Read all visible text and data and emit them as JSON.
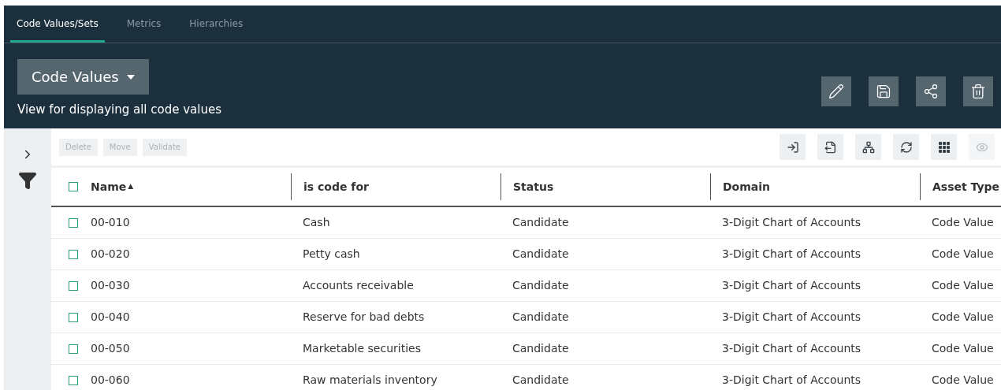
{
  "tabs": [
    {
      "label": "Code Values/Sets",
      "selected": true
    },
    {
      "label": "Metrics",
      "selected": false
    },
    {
      "label": "Hierarchies",
      "selected": false
    }
  ],
  "view_selector": {
    "label": "Code Values"
  },
  "view_description": "View for displaying all code values",
  "toolbar_buttons": [
    {
      "label": "Delete",
      "disabled": true
    },
    {
      "label": "Move",
      "disabled": true
    },
    {
      "label": "Validate",
      "disabled": true
    }
  ],
  "table": {
    "select_all_checked": false,
    "sort_indicator": "▲",
    "columns": [
      "Name",
      "is code for",
      "Status",
      "Domain",
      "Asset Type"
    ],
    "rows": [
      {
        "checked": false,
        "cells": [
          "00-010",
          "Cash",
          "Candidate",
          "3-Digit Chart of Accounts",
          "Code Value"
        ]
      },
      {
        "checked": false,
        "cells": [
          "00-020",
          "Petty cash",
          "Candidate",
          "3-Digit Chart of Accounts",
          "Code Value"
        ]
      },
      {
        "checked": false,
        "cells": [
          "00-030",
          "Accounts receivable",
          "Candidate",
          "3-Digit Chart of Accounts",
          "Code Value"
        ]
      },
      {
        "checked": false,
        "cells": [
          "00-040",
          "Reserve for bad debts",
          "Candidate",
          "3-Digit Chart of Accounts",
          "Code Value"
        ]
      },
      {
        "checked": false,
        "cells": [
          "00-050",
          "Marketable securities",
          "Candidate",
          "3-Digit Chart of Accounts",
          "Code Value"
        ]
      },
      {
        "checked": false,
        "cells": [
          "00-060",
          "Raw materials inventory",
          "Candidate",
          "3-Digit Chart of Accounts",
          "Code Value"
        ]
      }
    ]
  }
}
